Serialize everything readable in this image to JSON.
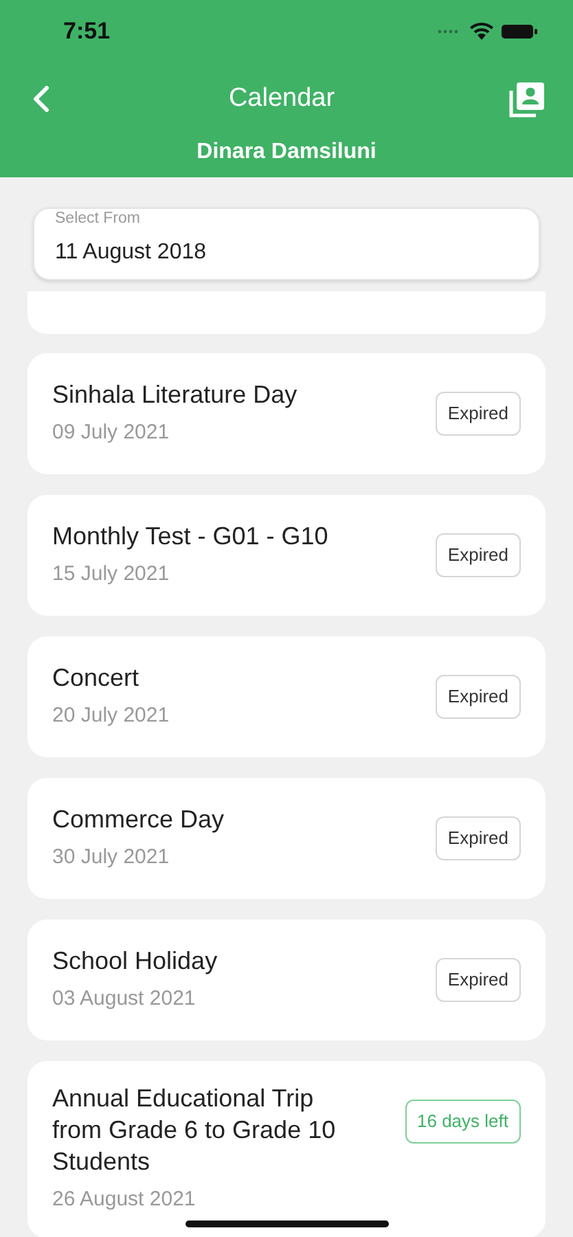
{
  "status_bar": {
    "time": "7:51"
  },
  "header": {
    "title": "Calendar",
    "subtitle": "Dinara Damsiluni"
  },
  "date_field": {
    "label": "Select From",
    "value": "11 August 2018"
  },
  "events": [
    {
      "title": "Sinhala Literature Day",
      "date": "09 July 2021",
      "status": {
        "kind": "expired",
        "text": "Expired"
      }
    },
    {
      "title": "Monthly Test - G01 - G10",
      "date": "15 July 2021",
      "status": {
        "kind": "expired",
        "text": "Expired"
      }
    },
    {
      "title": "Concert",
      "date": "20 July 2021",
      "status": {
        "kind": "expired",
        "text": "Expired"
      }
    },
    {
      "title": "Commerce Day",
      "date": "30 July 2021",
      "status": {
        "kind": "expired",
        "text": "Expired"
      }
    },
    {
      "title": "School Holiday",
      "date": "03 August 2021",
      "status": {
        "kind": "expired",
        "text": "Expired"
      }
    },
    {
      "title": "Annual Educational Trip from Grade 6 to Grade 10 Students",
      "date": "26 August 2021",
      "status": {
        "kind": "upcoming",
        "text": "16 days left"
      }
    }
  ]
}
